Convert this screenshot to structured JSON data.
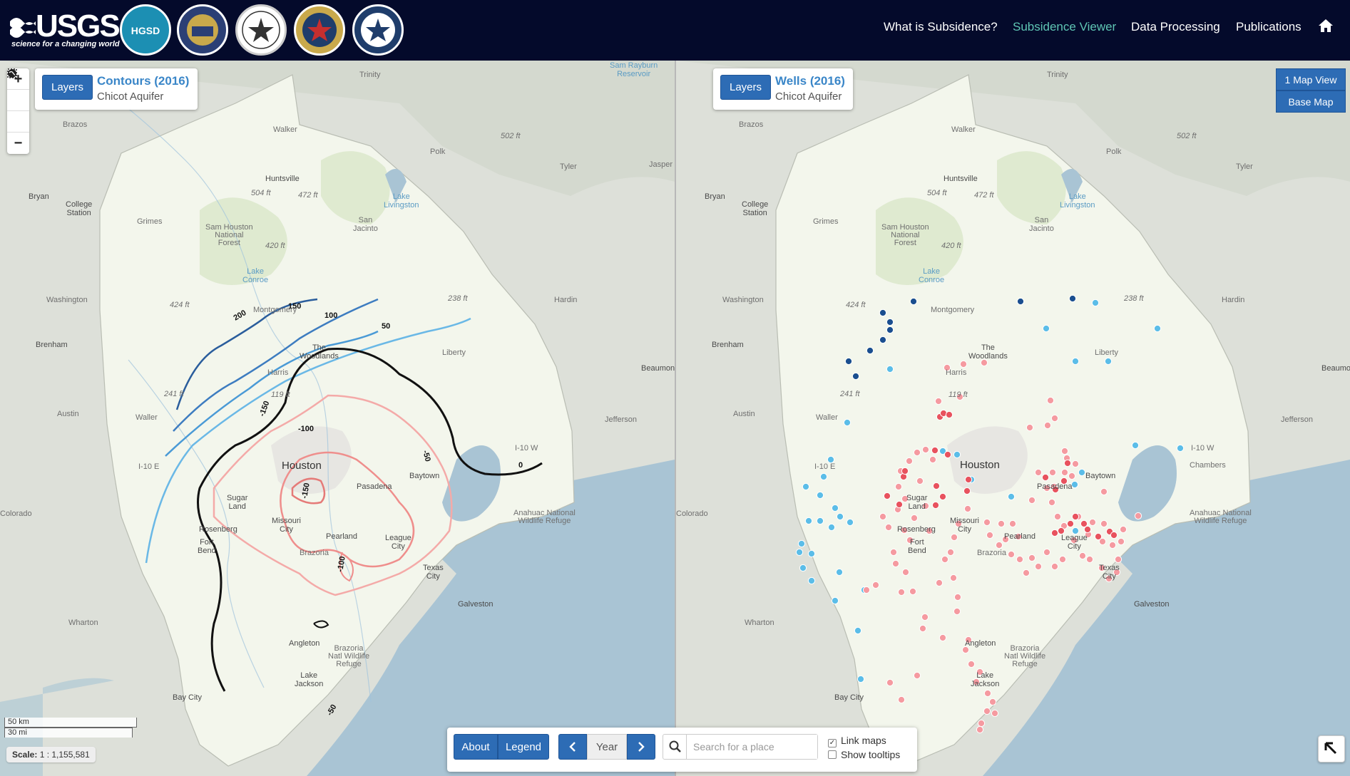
{
  "header": {
    "usgs_word": "USGS",
    "usgs_tagline": "science for a changing world",
    "seals": [
      {
        "name": "hgsd-seal",
        "text": "HGSD",
        "color": "#1c8fb3"
      },
      {
        "name": "harris-county-seal",
        "text": "",
        "color": "#2b3f75"
      },
      {
        "name": "fort-bend-seal",
        "text": "",
        "color": "#ffffff"
      },
      {
        "name": "lone-star-seal",
        "text": "",
        "color": "#c62f2f"
      },
      {
        "name": "conroe-seal",
        "text": "",
        "color": "#1f3d6b"
      }
    ],
    "nav": [
      {
        "label": "What is Subsidence?",
        "active": false
      },
      {
        "label": "Subsidence Viewer",
        "active": true
      },
      {
        "label": "Data Processing",
        "active": false
      },
      {
        "label": "Publications",
        "active": false
      }
    ],
    "home_icon": "home-icon"
  },
  "left_map": {
    "layers_button": "Layers",
    "title": "Contours (2016)",
    "subtitle": "Chicot Aquifer",
    "zoom": {
      "in": "+",
      "globe": "globe-icon",
      "select": "select-box-icon",
      "out": "−"
    },
    "contour_labels": [
      "200",
      "150",
      "100",
      "50",
      "0",
      "-100",
      "-150",
      "-50",
      "-100",
      "-150",
      "-100",
      "-50"
    ],
    "scale": {
      "km": "50 km",
      "mi": "30 mi",
      "scale_label": "Scale:",
      "scale_value": "1 : 1,155,581"
    }
  },
  "right_map": {
    "layers_button": "Layers",
    "title": "Wells (2016)",
    "subtitle": "Chicot Aquifer",
    "view_button": "1 Map View",
    "basemap_button": "Base Map"
  },
  "map_places": {
    "houston": "Houston",
    "pasadena": "Pasadena",
    "baytown": "Baytown",
    "sugar_land": "Sugar\nLand",
    "missouri_city": "Missouri\nCity",
    "rosenberg": "Rosenberg",
    "fort_bend": "Fort\nBend",
    "pearland": "Pearland",
    "league_city": "League\nCity",
    "texas_city": "Texas\nCity",
    "galveston": "Galveston",
    "angleton": "Angleton",
    "lake_jackson": "Lake\nJackson",
    "bay_city": "Bay City",
    "the_woodlands": "The\nWoodlands",
    "huntsville": "Huntsville",
    "conroe_lake": "Lake\nConroe",
    "liberty": "Liberty",
    "chambers": "Chambers",
    "waller": "Waller",
    "montgomery": "Montgomery",
    "harris": "Harris",
    "walker": "Walker",
    "brazoria": "Brazoria",
    "wharton": "Wharton",
    "austin": "Austin",
    "colorado": "Colorado",
    "brenham": "Brenham",
    "bryan": "Bryan",
    "college_station": "College\nStation",
    "grimes": "Grimes",
    "washington": "Washington",
    "brazos": "Brazos",
    "polk": "Polk",
    "tyler": "Tyler",
    "jasper": "Jasper",
    "hardin": "Hardin",
    "jefferson": "Jefferson",
    "beaumont": "Beaumont",
    "trinity": "Trinity",
    "san_jacinto": "San\nJacinto",
    "sam_houston_forest": "Sam Houston\nNational\nForest",
    "brazoria_refuge": "Brazoria\nNatl Wildlife\nRefuge",
    "anahuac_refuge": "Anahuac National\nWildlife Refuge",
    "lake_livingston": "Lake\nLivingston",
    "sam_rayburn": "Sam Rayburn\nReservoir",
    "elev_504": "504 ft",
    "elev_472": "472 ft",
    "elev_420": "420 ft",
    "elev_424": "424 ft",
    "elev_241": "241 ft",
    "elev_119": "119 ft",
    "elev_238": "238 ft",
    "elev_502": "502 ft",
    "i10e": "I-10 E",
    "i10w": "I-10 W"
  },
  "bottom_bar": {
    "about": "About",
    "legend": "Legend",
    "prev_icon": "chevron-left-icon",
    "year": "Year",
    "next_icon": "chevron-right-icon",
    "search_icon": "search-icon",
    "search_placeholder": "Search for a place",
    "link_maps": "Link maps",
    "link_maps_checked": true,
    "show_tooltips": "Show tooltips",
    "show_tooltips_checked": false
  },
  "expand_icon": "collapse-arrow-icon",
  "colors": {
    "header_bg": "#040a2b",
    "nav_active": "#5fc6b4",
    "button_blue": "#2d6cb5",
    "region_fill": "#f3f6ec",
    "water": "#a9c4d4",
    "contour_positive_dark": "#2a5d9c",
    "contour_positive_mid": "#3d8fd0",
    "contour_positive_light": "#6ab8e6",
    "contour_zero": "#111111",
    "contour_negative": "#f09a98",
    "well_dark_blue": "#1a4e8f",
    "well_light_blue": "#5bbde8",
    "well_pink": "#f59aa0",
    "well_red": "#e8525e"
  }
}
